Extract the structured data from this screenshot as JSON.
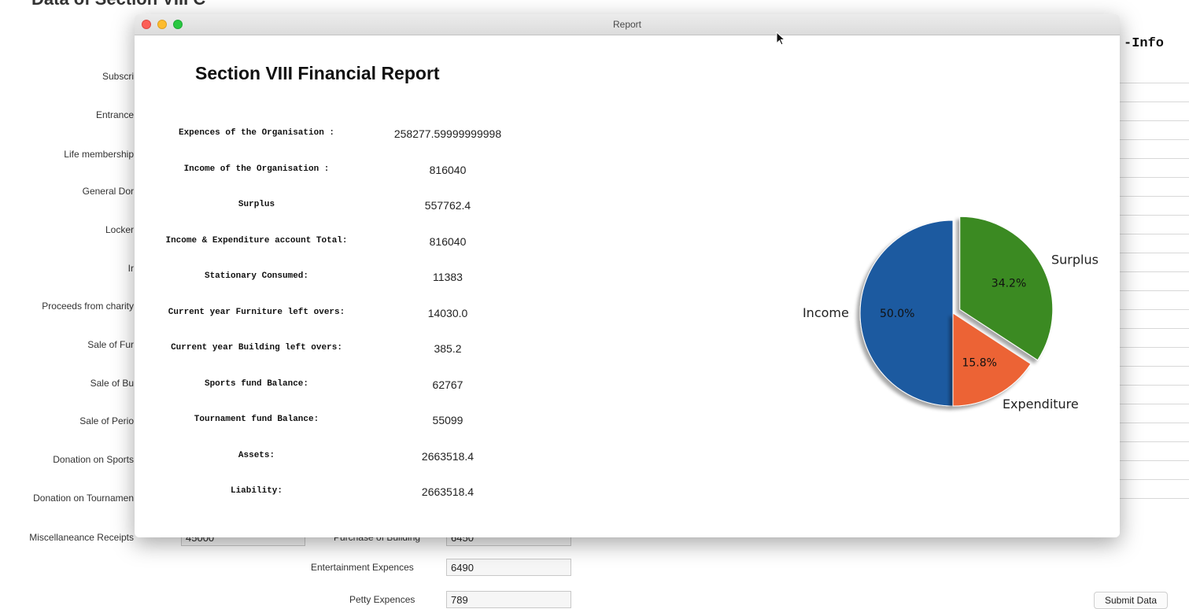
{
  "background": {
    "title": "Data of Section VIII C",
    "left_labels": [
      "Subscri",
      "Entrance",
      "Life membership",
      "General Dor",
      "Locker",
      "Ir",
      "Proceeds from charity",
      "Sale of Fur",
      "Sale of Bu",
      "Sale of Perio",
      "Donation on Sports",
      "Donation on Tournamen",
      "Miscellaneance Receipts"
    ],
    "misc_receipts_value": "45000",
    "purchase_building_label": "Purchase of Building",
    "purchase_building_value": "6450",
    "entertainment_label": "Entertainment Expences",
    "entertainment_value": "6490",
    "petty_label": "Petty Expences",
    "petty_value": "789",
    "info_heading": "-Info",
    "submit_label": "Submit Data"
  },
  "window": {
    "title": "Report"
  },
  "report": {
    "heading": "Section VIII Financial Report",
    "rows": [
      {
        "label": "Expences of the Organisation :",
        "value": "258277.59999999998"
      },
      {
        "label": "Income of the Organisation :",
        "value": "816040"
      },
      {
        "label": "Surplus",
        "value": "557762.4"
      },
      {
        "label": "Income & Expenditure account Total:",
        "value": "816040"
      },
      {
        "label": "Stationary Consumed:",
        "value": "11383"
      },
      {
        "label": "Current year Furniture left overs:",
        "value": "14030.0"
      },
      {
        "label": "Current year Building left overs:",
        "value": "385.2"
      },
      {
        "label": "Sports fund Balance:",
        "value": "62767"
      },
      {
        "label": "Tournament fund Balance:",
        "value": "55099"
      },
      {
        "label": "Assets:",
        "value": "2663518.4"
      },
      {
        "label": "Liability:",
        "value": "2663518.4"
      }
    ]
  },
  "chart_data": {
    "type": "pie",
    "categories": [
      "Income",
      "Expenditure",
      "Surplus"
    ],
    "values": [
      50.0,
      15.8,
      34.2
    ],
    "value_labels": [
      "50.0%",
      "15.8%",
      "34.2%"
    ],
    "colors": [
      "#1f5aa0",
      "#ec6334",
      "#3b8a23"
    ],
    "exploded": [
      "Surplus"
    ],
    "shadow": true
  }
}
